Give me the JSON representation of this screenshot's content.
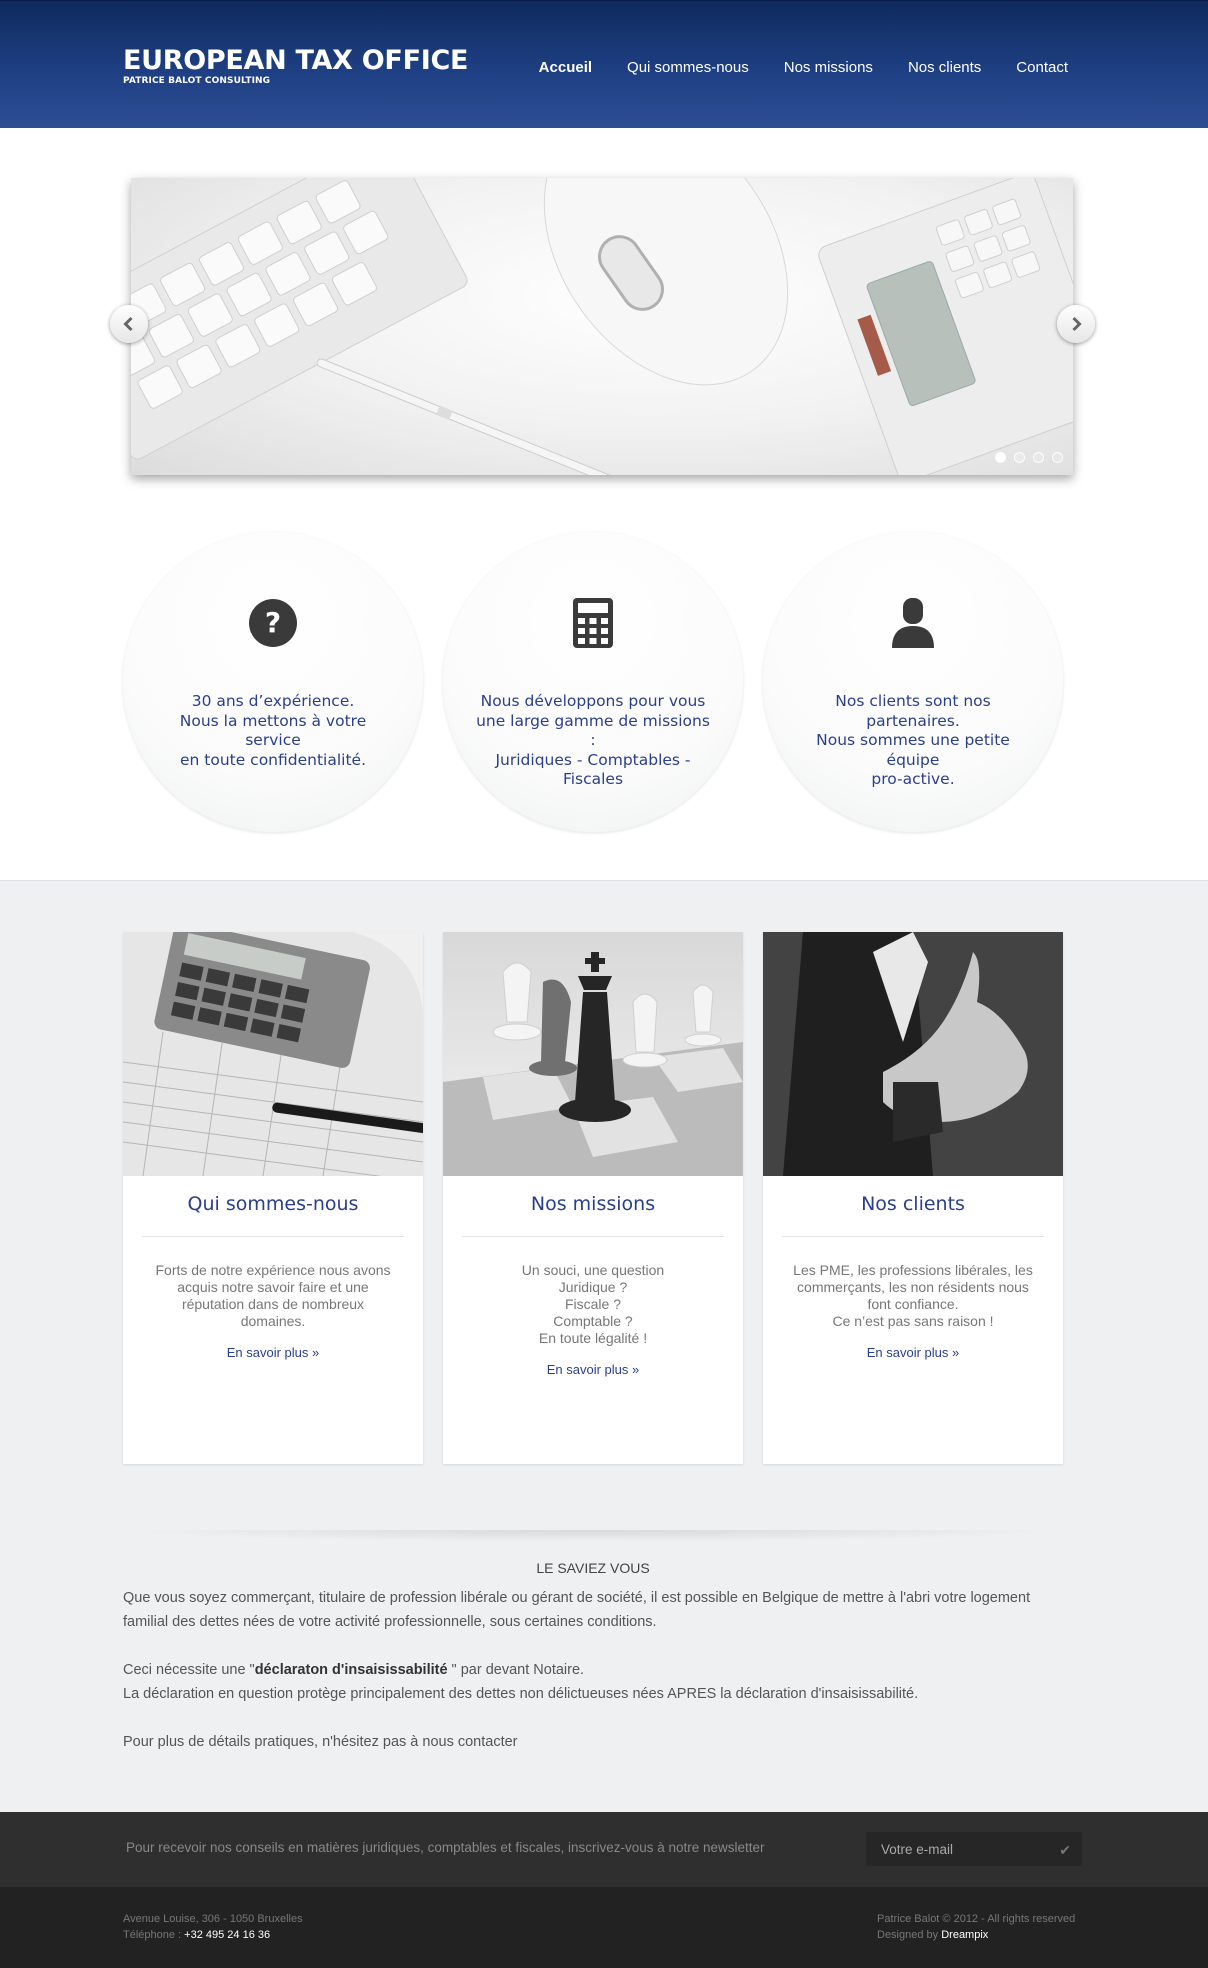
{
  "header": {
    "logo_title": "EUROPEAN TAX OFFICE",
    "logo_subtitle": "PATRICE BALOT CONSULTING",
    "nav": [
      "Accueil",
      "Qui sommes-nous",
      "Nos missions",
      "Nos clients",
      "Contact"
    ],
    "active_nav": "Accueil"
  },
  "slider": {
    "slide_count": 4,
    "active_slide": 1,
    "prev_icon": "chevron-left-icon",
    "next_icon": "chevron-right-icon"
  },
  "features": [
    {
      "icon": "question-icon",
      "lines": [
        "30 ans d’expérience.",
        "Nous la mettons à votre service",
        "en toute confidentialité."
      ]
    },
    {
      "icon": "calculator-icon",
      "lines": [
        "Nous développons pour vous",
        "une large gamme de missions :",
        "Juridiques - Comptables -",
        "Fiscales"
      ]
    },
    {
      "icon": "user-icon",
      "lines": [
        "Nos clients sont nos partenaires.",
        "Nous sommes une petite équipe",
        "pro-active."
      ]
    }
  ],
  "cards": [
    {
      "title": "Qui sommes-nous",
      "lines": [
        "Forts de notre expérience nous avons",
        "acquis notre savoir faire et une",
        "réputation dans de nombreux",
        "domaines."
      ],
      "more": "En savoir plus »"
    },
    {
      "title": "Nos missions",
      "lines": [
        "Un souci, une question",
        "Juridique ?",
        "Fiscale ?",
        "Comptable ?",
        "En toute légalité !"
      ],
      "more": "En savoir plus »"
    },
    {
      "title": "Nos clients",
      "lines": [
        "Les PME, les professions libérales, les",
        "commerçants, les non résidents nous",
        "font confiance.",
        "Ce n’est pas sans raison !"
      ],
      "more": "En savoir plus »"
    }
  ],
  "saviez": {
    "title": "LE SAVIEZ VOUS",
    "p1": "Que vous soyez commerçant, titulaire de profession libérale ou gérant de société, il est  possible en Belgique de mettre à l'abri votre logement familial des dettes nées de votre activité professionnelle, sous certaines conditions.",
    "p2_pre": "Ceci nécessite une \"",
    "p2_bold": "déclaraton d'insaisissabilité",
    "p2_post": " \" par devant Notaire.",
    "p2_line2": "La déclaration en question protège principalement des dettes non délictueuses nées APRES la déclaration d'insaisissabilité.",
    "p3": "Pour plus de détails pratiques, n'hésitez pas à nous contacter"
  },
  "newsletter": {
    "text": "Pour recevoir nos conseils en matières juridiques, comptables et fiscales, inscrivez-vous à notre newsletter",
    "placeholder": "Votre e-mail",
    "submit_icon": "check-icon"
  },
  "footer": {
    "address": "Avenue Louise, 306 - 1050 Bruxelles",
    "phone_label": "Téléphone : ",
    "phone": "+32 495 24 16 36",
    "copyright": "Patrice Balot © 2012 - All rights reserved",
    "designed_by_label": "Designed by ",
    "designed_by": "Dreampix"
  },
  "colors": {
    "accent": "#2a3f8a",
    "header_dark": "#0e2a5e",
    "header_light": "#2e4d96",
    "section_gray": "#eef0f2",
    "footer_dark": "#222222"
  }
}
